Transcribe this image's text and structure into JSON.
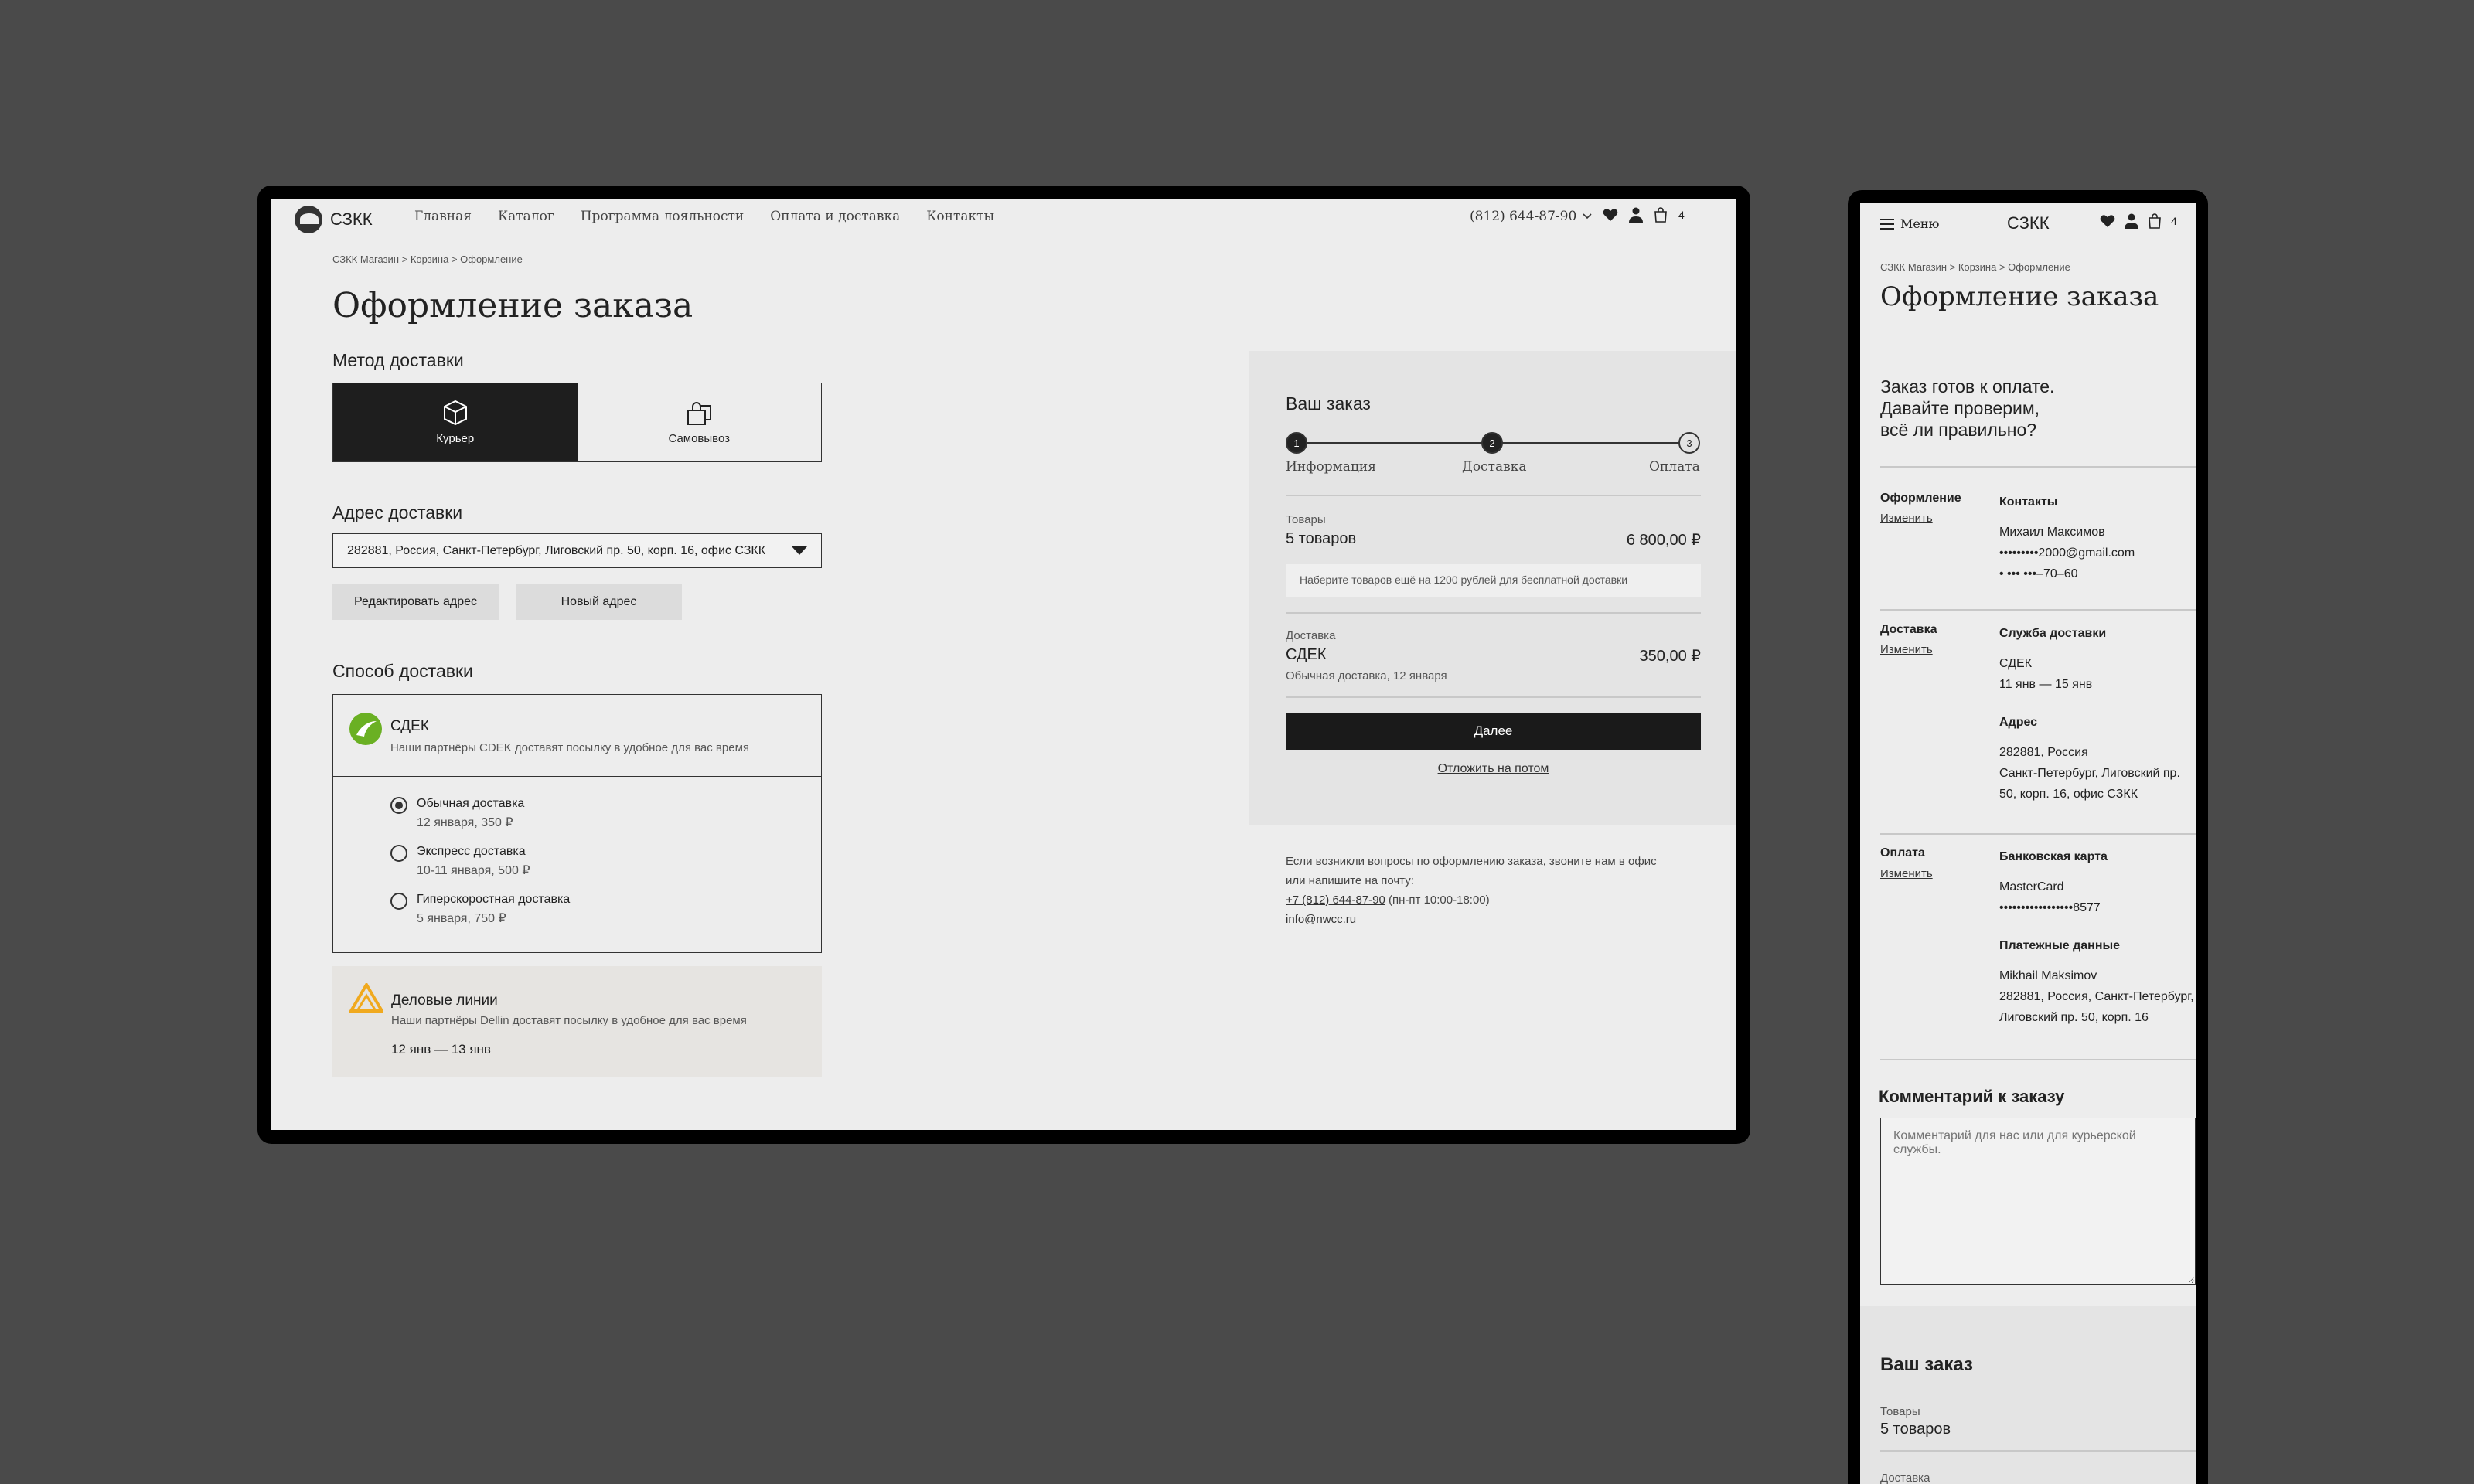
{
  "brand": {
    "name": "СЗКК"
  },
  "nav": [
    "Главная",
    "Каталог",
    "Программа лояльности",
    "Оплата и доставка",
    "Контакты"
  ],
  "header": {
    "phone": "(812) 644-87-90",
    "cart_count": "4",
    "menu_label": "Меню"
  },
  "breadcrumb": "СЗКК Магазин > Корзина > Оформление",
  "page_title": "Оформление заказа",
  "delivery_method": {
    "title": "Метод доставки",
    "courier": "Курьер",
    "pickup": "Самовывоз"
  },
  "address": {
    "title": "Адрес доставки",
    "selected": "282881, Россия, Санкт-Петербург, Лиговский пр. 50, корп. 16, офис СЗКК",
    "edit_btn": "Редактировать адрес",
    "new_btn": "Новый адрес"
  },
  "shipping": {
    "title": "Способ доставки",
    "cdek": {
      "name": "СДЕК",
      "desc": "Наши партнёры CDEK доставят посылку в удобное для вас время",
      "options": [
        {
          "label": "Обычная доставка",
          "detail": "12 января, 350 ₽"
        },
        {
          "label": "Экспресс доставка",
          "detail": "10-11 января, 500 ₽"
        },
        {
          "label": "Гиперскоростная доставка",
          "detail": "5 января, 750 ₽"
        }
      ]
    },
    "dellin": {
      "name": "Деловые линии",
      "desc": "Наши партнёры Dellin доставят посылку в удобное для вас время",
      "dates": "12 янв — 13 янв"
    }
  },
  "summary": {
    "title": "Ваш заказ",
    "steps": [
      {
        "num": "1",
        "label": "Информация"
      },
      {
        "num": "2",
        "label": "Доставка"
      },
      {
        "num": "3",
        "label": "Оплата"
      }
    ],
    "goods_label": "Товары",
    "goods_count": "5 товаров",
    "goods_total": "6 800,00 ₽",
    "free_note": "Наберите товаров ещё на 1200 рублей для бесплатной доставки",
    "delivery_label": "Доставка",
    "delivery_name": "СДЕК",
    "delivery_price": "350,00 ₽",
    "delivery_detail": "Обычная доставка, 12 января",
    "next_btn": "Далее",
    "later_link": "Отложить на потом"
  },
  "help": {
    "line1": "Если возникли вопросы по оформлению заказа, звоните нам в офис",
    "line2": "или напишите на почту:",
    "phone": "+7 (812) 644-87-90",
    "hours": "(пн-пт 10:00-18:00)",
    "email": "info@nwcc.ru"
  },
  "mobile": {
    "ready_title": [
      "Заказ готов к оплате.",
      "Давайте проверим,",
      "всё ли правильно?"
    ],
    "change": "Изменить",
    "sections": {
      "order": {
        "label": "Оформление",
        "title": "Контакты",
        "lines": [
          "Михаил Максимов",
          "•••••••••2000@gmail.com",
          "• ••• •••–70–60"
        ]
      },
      "delivery": {
        "label": "Доставка",
        "title": "Служба доставки",
        "lines": [
          "СДЕК",
          "11 янв — 15 янв"
        ],
        "addr_title": "Адрес",
        "addr_lines": [
          "282881, Россия",
          "Санкт-Петербург, Лиговский пр.",
          "50, корп. 16, офис СЗКК"
        ]
      },
      "payment": {
        "label": "Оплата",
        "title": "Банковская карта",
        "lines": [
          "MasterCard",
          "•••••••••••••••••8577"
        ],
        "pay_title": "Платежные данные",
        "pay_lines": [
          "Mikhail Maksimov",
          "282881, Россия, Санкт-Петербург,",
          "Лиговский пр. 50, корп. 16"
        ]
      }
    },
    "comment_title": "Комментарий к заказу",
    "comment_placeholder": "Комментарий для нас или для курьерской службы."
  },
  "colors": {
    "bg": "#4a4a4a",
    "screen": "#ededed",
    "dark": "#1e1e1e",
    "cdek": "#6ab023",
    "dellin": "#f0a91e"
  }
}
